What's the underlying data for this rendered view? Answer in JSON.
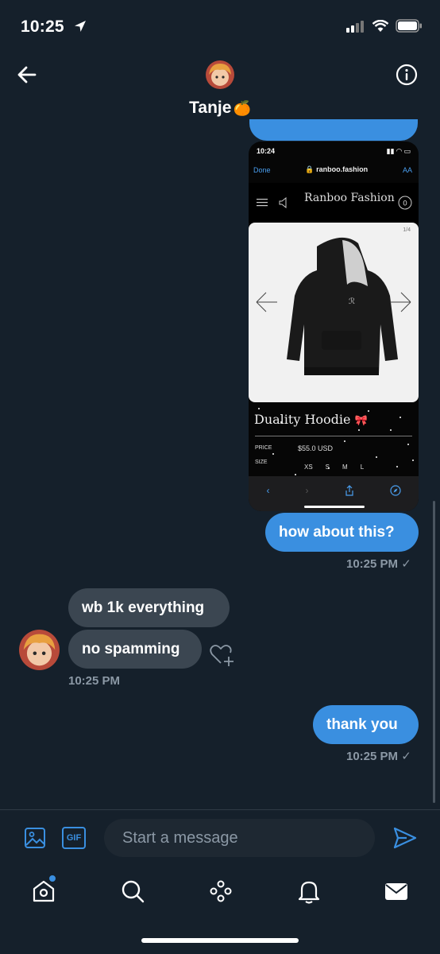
{
  "status_bar": {
    "time": "10:25"
  },
  "header": {
    "title": "Tanje",
    "title_emoji": "🍊"
  },
  "shared_screenshot": {
    "time": "10:24",
    "done_label": "Done",
    "domain": "ranboo.fashion",
    "text_size_label": "AA",
    "brand": "Ranboo Fashion",
    "image_counter": "1/4",
    "product_name": "Duality Hoodie",
    "product_emoji": "🎀",
    "price_label": "PRICE",
    "price": "$55.0 USD",
    "size_label": "SIZE",
    "sizes": [
      "XS",
      "S",
      "M",
      "L"
    ]
  },
  "messages": [
    {
      "direction": "outgoing",
      "text": "how about this?",
      "time": "10:25 PM",
      "status": "✓"
    },
    {
      "direction": "incoming",
      "text": "wb 1k everything"
    },
    {
      "direction": "incoming",
      "text": "no spamming",
      "time": "10:25 PM"
    },
    {
      "direction": "outgoing",
      "text": "thank you",
      "time": "10:25 PM",
      "status": "✓"
    }
  ],
  "composer": {
    "placeholder": "Start a message",
    "gif_label": "GIF"
  },
  "colors": {
    "background": "#15202b",
    "accent": "#3a8fe0",
    "incoming_bubble": "#3b4651",
    "muted_text": "#8b98a5"
  }
}
